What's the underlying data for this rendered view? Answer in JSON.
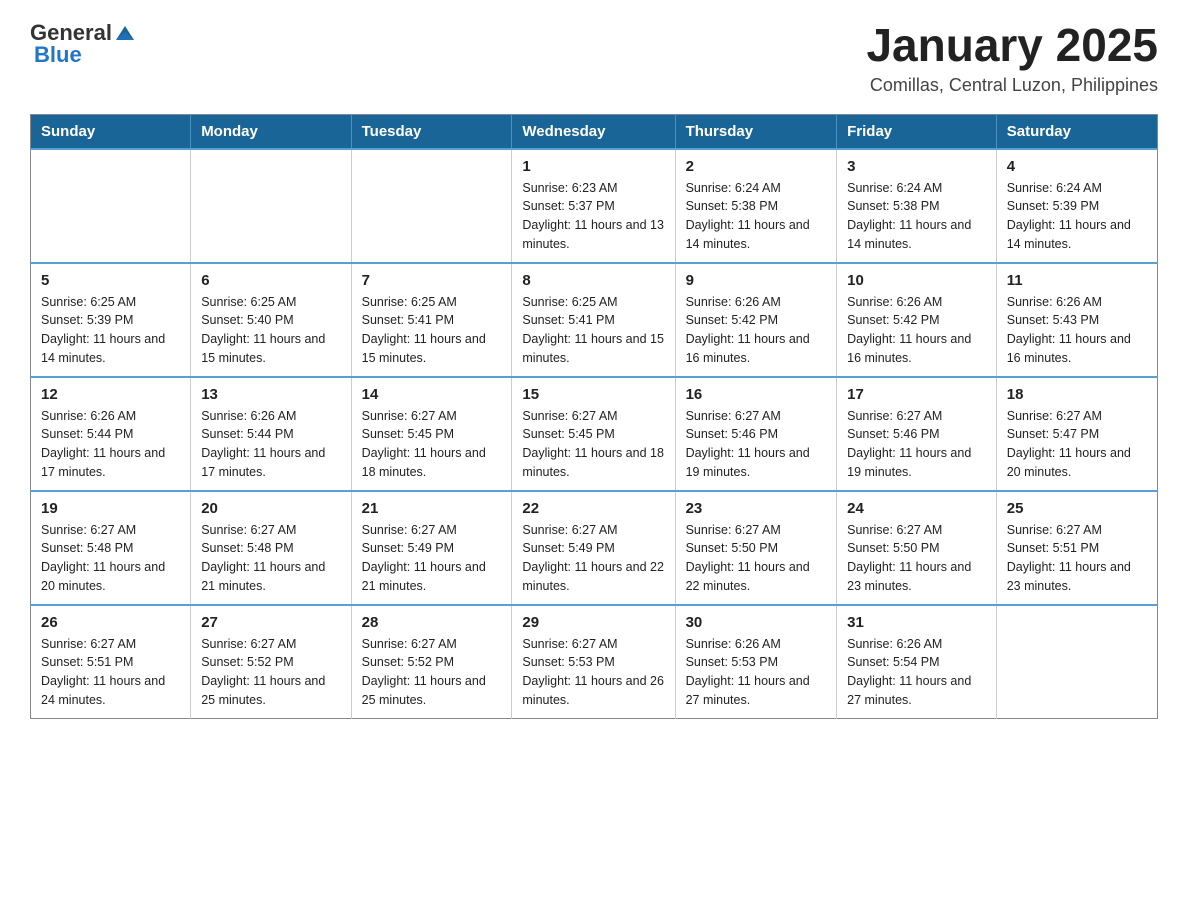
{
  "header": {
    "logo_general": "General",
    "logo_blue": "Blue",
    "month_year": "January 2025",
    "location": "Comillas, Central Luzon, Philippines"
  },
  "days_of_week": [
    "Sunday",
    "Monday",
    "Tuesday",
    "Wednesday",
    "Thursday",
    "Friday",
    "Saturday"
  ],
  "weeks": [
    [
      {
        "day": "",
        "sunrise": "",
        "sunset": "",
        "daylight": ""
      },
      {
        "day": "",
        "sunrise": "",
        "sunset": "",
        "daylight": ""
      },
      {
        "day": "",
        "sunrise": "",
        "sunset": "",
        "daylight": ""
      },
      {
        "day": "1",
        "sunrise": "Sunrise: 6:23 AM",
        "sunset": "Sunset: 5:37 PM",
        "daylight": "Daylight: 11 hours and 13 minutes."
      },
      {
        "day": "2",
        "sunrise": "Sunrise: 6:24 AM",
        "sunset": "Sunset: 5:38 PM",
        "daylight": "Daylight: 11 hours and 14 minutes."
      },
      {
        "day": "3",
        "sunrise": "Sunrise: 6:24 AM",
        "sunset": "Sunset: 5:38 PM",
        "daylight": "Daylight: 11 hours and 14 minutes."
      },
      {
        "day": "4",
        "sunrise": "Sunrise: 6:24 AM",
        "sunset": "Sunset: 5:39 PM",
        "daylight": "Daylight: 11 hours and 14 minutes."
      }
    ],
    [
      {
        "day": "5",
        "sunrise": "Sunrise: 6:25 AM",
        "sunset": "Sunset: 5:39 PM",
        "daylight": "Daylight: 11 hours and 14 minutes."
      },
      {
        "day": "6",
        "sunrise": "Sunrise: 6:25 AM",
        "sunset": "Sunset: 5:40 PM",
        "daylight": "Daylight: 11 hours and 15 minutes."
      },
      {
        "day": "7",
        "sunrise": "Sunrise: 6:25 AM",
        "sunset": "Sunset: 5:41 PM",
        "daylight": "Daylight: 11 hours and 15 minutes."
      },
      {
        "day": "8",
        "sunrise": "Sunrise: 6:25 AM",
        "sunset": "Sunset: 5:41 PM",
        "daylight": "Daylight: 11 hours and 15 minutes."
      },
      {
        "day": "9",
        "sunrise": "Sunrise: 6:26 AM",
        "sunset": "Sunset: 5:42 PM",
        "daylight": "Daylight: 11 hours and 16 minutes."
      },
      {
        "day": "10",
        "sunrise": "Sunrise: 6:26 AM",
        "sunset": "Sunset: 5:42 PM",
        "daylight": "Daylight: 11 hours and 16 minutes."
      },
      {
        "day": "11",
        "sunrise": "Sunrise: 6:26 AM",
        "sunset": "Sunset: 5:43 PM",
        "daylight": "Daylight: 11 hours and 16 minutes."
      }
    ],
    [
      {
        "day": "12",
        "sunrise": "Sunrise: 6:26 AM",
        "sunset": "Sunset: 5:44 PM",
        "daylight": "Daylight: 11 hours and 17 minutes."
      },
      {
        "day": "13",
        "sunrise": "Sunrise: 6:26 AM",
        "sunset": "Sunset: 5:44 PM",
        "daylight": "Daylight: 11 hours and 17 minutes."
      },
      {
        "day": "14",
        "sunrise": "Sunrise: 6:27 AM",
        "sunset": "Sunset: 5:45 PM",
        "daylight": "Daylight: 11 hours and 18 minutes."
      },
      {
        "day": "15",
        "sunrise": "Sunrise: 6:27 AM",
        "sunset": "Sunset: 5:45 PM",
        "daylight": "Daylight: 11 hours and 18 minutes."
      },
      {
        "day": "16",
        "sunrise": "Sunrise: 6:27 AM",
        "sunset": "Sunset: 5:46 PM",
        "daylight": "Daylight: 11 hours and 19 minutes."
      },
      {
        "day": "17",
        "sunrise": "Sunrise: 6:27 AM",
        "sunset": "Sunset: 5:46 PM",
        "daylight": "Daylight: 11 hours and 19 minutes."
      },
      {
        "day": "18",
        "sunrise": "Sunrise: 6:27 AM",
        "sunset": "Sunset: 5:47 PM",
        "daylight": "Daylight: 11 hours and 20 minutes."
      }
    ],
    [
      {
        "day": "19",
        "sunrise": "Sunrise: 6:27 AM",
        "sunset": "Sunset: 5:48 PM",
        "daylight": "Daylight: 11 hours and 20 minutes."
      },
      {
        "day": "20",
        "sunrise": "Sunrise: 6:27 AM",
        "sunset": "Sunset: 5:48 PM",
        "daylight": "Daylight: 11 hours and 21 minutes."
      },
      {
        "day": "21",
        "sunrise": "Sunrise: 6:27 AM",
        "sunset": "Sunset: 5:49 PM",
        "daylight": "Daylight: 11 hours and 21 minutes."
      },
      {
        "day": "22",
        "sunrise": "Sunrise: 6:27 AM",
        "sunset": "Sunset: 5:49 PM",
        "daylight": "Daylight: 11 hours and 22 minutes."
      },
      {
        "day": "23",
        "sunrise": "Sunrise: 6:27 AM",
        "sunset": "Sunset: 5:50 PM",
        "daylight": "Daylight: 11 hours and 22 minutes."
      },
      {
        "day": "24",
        "sunrise": "Sunrise: 6:27 AM",
        "sunset": "Sunset: 5:50 PM",
        "daylight": "Daylight: 11 hours and 23 minutes."
      },
      {
        "day": "25",
        "sunrise": "Sunrise: 6:27 AM",
        "sunset": "Sunset: 5:51 PM",
        "daylight": "Daylight: 11 hours and 23 minutes."
      }
    ],
    [
      {
        "day": "26",
        "sunrise": "Sunrise: 6:27 AM",
        "sunset": "Sunset: 5:51 PM",
        "daylight": "Daylight: 11 hours and 24 minutes."
      },
      {
        "day": "27",
        "sunrise": "Sunrise: 6:27 AM",
        "sunset": "Sunset: 5:52 PM",
        "daylight": "Daylight: 11 hours and 25 minutes."
      },
      {
        "day": "28",
        "sunrise": "Sunrise: 6:27 AM",
        "sunset": "Sunset: 5:52 PM",
        "daylight": "Daylight: 11 hours and 25 minutes."
      },
      {
        "day": "29",
        "sunrise": "Sunrise: 6:27 AM",
        "sunset": "Sunset: 5:53 PM",
        "daylight": "Daylight: 11 hours and 26 minutes."
      },
      {
        "day": "30",
        "sunrise": "Sunrise: 6:26 AM",
        "sunset": "Sunset: 5:53 PM",
        "daylight": "Daylight: 11 hours and 27 minutes."
      },
      {
        "day": "31",
        "sunrise": "Sunrise: 6:26 AM",
        "sunset": "Sunset: 5:54 PM",
        "daylight": "Daylight: 11 hours and 27 minutes."
      },
      {
        "day": "",
        "sunrise": "",
        "sunset": "",
        "daylight": ""
      }
    ]
  ]
}
